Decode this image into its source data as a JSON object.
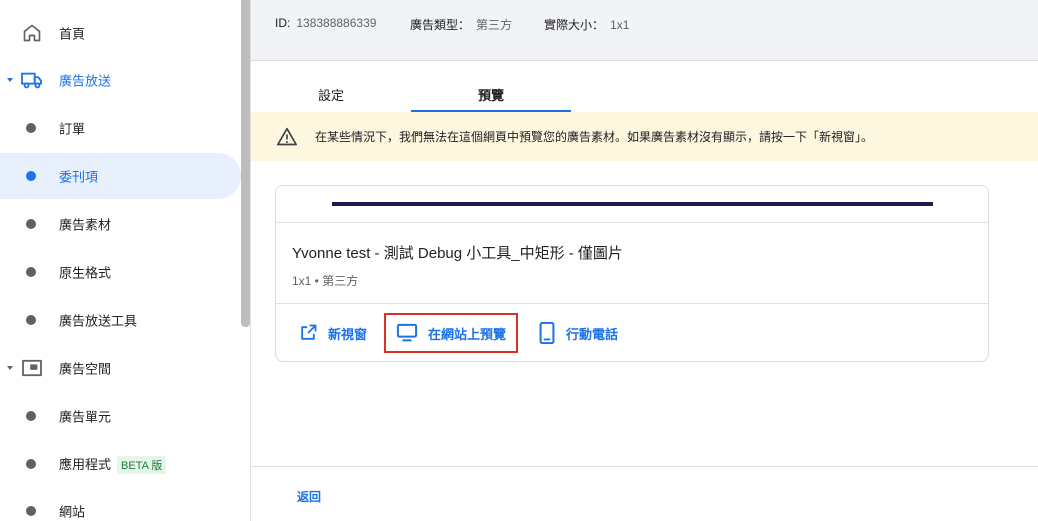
{
  "sidebar": {
    "items": [
      {
        "label": "首頁",
        "icon": "home-icon"
      },
      {
        "label": "廣告放送",
        "icon": "truck-icon"
      },
      {
        "label": "訂單"
      },
      {
        "label": "委刊項"
      },
      {
        "label": "廣告素材"
      },
      {
        "label": "原生格式"
      },
      {
        "label": "廣告放送工具"
      },
      {
        "label": "廣告空間",
        "icon": "inventory-icon"
      },
      {
        "label": "廣告單元"
      },
      {
        "label": "應用程式",
        "badge": "BETA 版"
      },
      {
        "label": "網站"
      }
    ]
  },
  "info": {
    "id_label": "ID:",
    "id_value": "138388886339",
    "type_label": "廣告類型：",
    "type_value": "第三方",
    "size_label": "實際大小：",
    "size_value": "1x1"
  },
  "tabs": {
    "settings": "設定",
    "preview": "預覽"
  },
  "warning": {
    "text": "在某些情況下，我們無法在這個網頁中預覽您的廣告素材。如果廣告素材沒有顯示，請按一下「新視窗」。"
  },
  "card": {
    "title": "Yvonne test - 測試 Debug 小工具_中矩形 - 僅圖片",
    "subtitle": "1x1 • 第三方",
    "actions": {
      "new_window": "新視窗",
      "preview_on_site": "在網站上預覽",
      "mobile": "行動電話"
    }
  },
  "footer": {
    "back": "返回"
  },
  "colors": {
    "accent": "#1a73e8",
    "highlight_border": "#d93025",
    "warning_bg": "#fef7e0",
    "beta_green": "#188038"
  }
}
